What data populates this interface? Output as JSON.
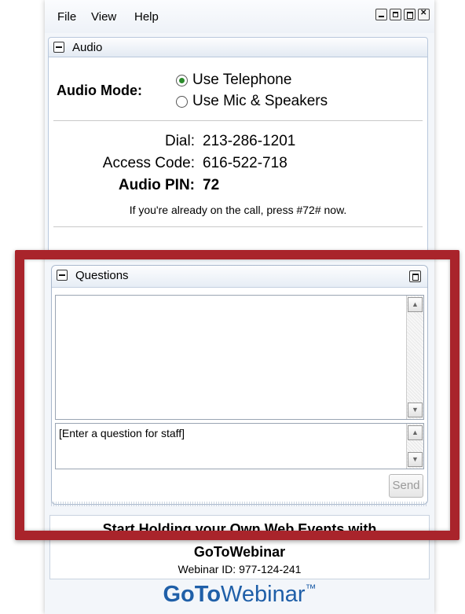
{
  "menu": {
    "file": "File",
    "view": "View",
    "help": "Help"
  },
  "audio": {
    "header": "Audio",
    "mode_label": "Audio Mode:",
    "options": [
      "Use Telephone",
      "Use Mic & Speakers"
    ],
    "selected": "Use Telephone",
    "dial_label": "Dial:",
    "dial_value": "213-286-1201",
    "access_label": "Access Code:",
    "access_value": "616-522-718",
    "pin_label": "Audio PIN:",
    "pin_value": "72",
    "note": "If you're already on the call, press #72# now."
  },
  "questions": {
    "header": "Questions",
    "input_placeholder": "[Enter a question for staff]",
    "send_label": "Send"
  },
  "promo": {
    "title_line1": "Start Holding your Own Web Events with",
    "title_line2": "GoToWebinar",
    "webinar_id": "Webinar ID: 977-124-241"
  },
  "logo": {
    "part1": "GoTo",
    "part2": "Webinar",
    "tm": "™"
  },
  "colors": {
    "highlight": "#a9242b",
    "logo": "#1f5fa8",
    "radio_selected": "#2a8a2a"
  }
}
